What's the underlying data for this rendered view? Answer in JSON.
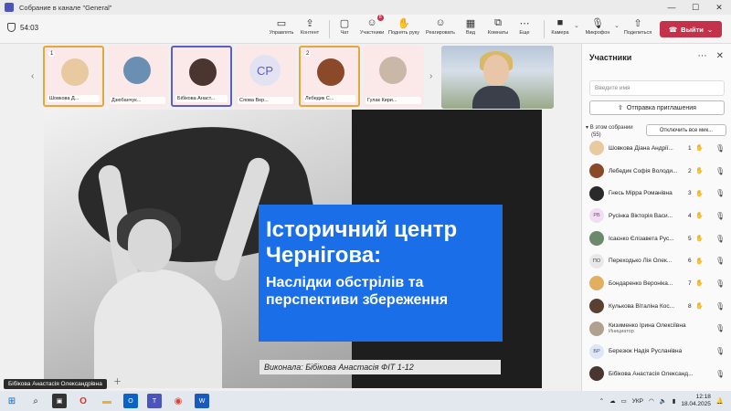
{
  "window": {
    "title": "Собрание в канале \"General\"",
    "minimize": "—",
    "maximize": "☐",
    "close": "✕"
  },
  "toolbar": {
    "timer": "54:03",
    "buttons": [
      {
        "label": "Управлять",
        "icon": "manage-icon"
      },
      {
        "label": "Контент",
        "icon": "content-share-icon"
      },
      {
        "label": "Чат",
        "icon": "chat-icon"
      },
      {
        "label": "Участники",
        "icon": "people-icon",
        "badge": "8"
      },
      {
        "label": "Поднять руку",
        "icon": "raise-hand-icon"
      },
      {
        "label": "Реагировать",
        "icon": "react-icon"
      },
      {
        "label": "Вид",
        "icon": "view-icon"
      },
      {
        "label": "Комнаты",
        "icon": "rooms-icon"
      },
      {
        "label": "Еще",
        "icon": "more-icon"
      },
      {
        "label": "Камера",
        "icon": "camera-icon"
      },
      {
        "label": "Микрофон",
        "icon": "microphone-icon"
      },
      {
        "label": "Поделиться",
        "icon": "share-icon"
      }
    ],
    "leave_label": "Выйти",
    "leave_color": "#c4314b"
  },
  "strip": {
    "tiles": [
      {
        "name": "Шовкова Д...",
        "hand": "1",
        "style": "hl",
        "kind": "photo",
        "color": "#e8c9a0"
      },
      {
        "name": "Дзюбанчук...",
        "kind": "photo",
        "color": "#6b8fb3"
      },
      {
        "name": "Бібікова Анаст...",
        "style": "sel",
        "kind": "photo",
        "color": "#4a3530"
      },
      {
        "name": "Сяова Вер...",
        "kind": "initials",
        "initials": "СР"
      },
      {
        "name": "Лебедик С...",
        "hand": "2",
        "style": "hl",
        "kind": "photo",
        "color": "#8a4a2a"
      },
      {
        "name": "Гулак Кири...",
        "kind": "photo",
        "color": "#c9b8a8"
      }
    ]
  },
  "slide": {
    "title_line1": "Історичний центр",
    "title_line2": "Чернігова:",
    "subtitle": "Наслідки обстрілів та перспективи збереження",
    "author": "Виконала: Бібікова Анастасія ФІТ 1-12",
    "accent": "#1a6fe8"
  },
  "presenter_label": "Бібікова Анастасія Олександрівна",
  "panel": {
    "title": "Участники",
    "search_placeholder": "Введите имя",
    "invite_label": "Отправка приглашения",
    "in_meeting": "В этом собрании",
    "in_meeting_count": "(55)",
    "mute_all": "Отключить все мик...",
    "participants": [
      {
        "name": "Шовкова Діана Андрії...",
        "num": "1",
        "hand": true,
        "avatar": "#e8c9a0",
        "initials": ""
      },
      {
        "name": "Лебедик Софія Володи...",
        "num": "2",
        "hand": true,
        "avatar": "#8a4a2a",
        "initials": ""
      },
      {
        "name": "Гнесь Мірра Романівна",
        "num": "3",
        "hand": true,
        "avatar": "#2a2a2a",
        "initials": ""
      },
      {
        "name": "Русінка Вікторія Васи...",
        "num": "4",
        "hand": true,
        "avatar": "#f0dff0",
        "initials": "РВ"
      },
      {
        "name": "Ісаєнко Єлізавета Рус...",
        "num": "5",
        "hand": true,
        "avatar": "#6b8a6b",
        "initials": ""
      },
      {
        "name": "Переходько Лія Олек...",
        "num": "6",
        "hand": true,
        "avatar": "#e8e8e8",
        "initials": "ПО"
      },
      {
        "name": "Бондаренко Вероніка...",
        "num": "7",
        "hand": true,
        "avatar": "#e0b060",
        "initials": ""
      },
      {
        "name": "Кулькова Віталіна Кос...",
        "num": "8",
        "hand": true,
        "avatar": "#5a4030",
        "initials": ""
      },
      {
        "name": "Кизименко Ірина Олексіївна",
        "role": "Инициатор",
        "avatar": "#b0a090",
        "initials": ""
      },
      {
        "name": "Березюк Надія Русланівна",
        "avatar": "#dde6f2",
        "initials": "БР"
      },
      {
        "name": "Бібікова Анастасія Олександ...",
        "avatar": "#4a3530",
        "initials": ""
      }
    ]
  },
  "taskbar": {
    "lang": "УКР",
    "time": "12:18",
    "date": "18.04.2025"
  }
}
